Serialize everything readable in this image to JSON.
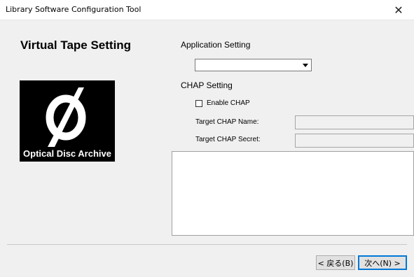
{
  "window": {
    "title": "Library Software Configuration Tool",
    "close_glyph": "✕"
  },
  "page": {
    "title": "Virtual Tape Setting"
  },
  "logo": {
    "text": "Optical Disc Archive"
  },
  "application_setting": {
    "label": "Application Setting",
    "value": ""
  },
  "chap": {
    "section_label": "CHAP Setting",
    "enable_label": "Enable CHAP",
    "enable_checked": false,
    "target_name_label": "Target CHAP Name:",
    "target_name_value": "",
    "target_secret_label": "Target CHAP Secret:",
    "target_secret_value": ""
  },
  "log": {
    "text": ""
  },
  "buttons": {
    "back_label": "< 戻る(B)",
    "next_label": "次へ(N) >"
  },
  "colors": {
    "accent": "#0078d7",
    "logo_bg": "#000000"
  }
}
